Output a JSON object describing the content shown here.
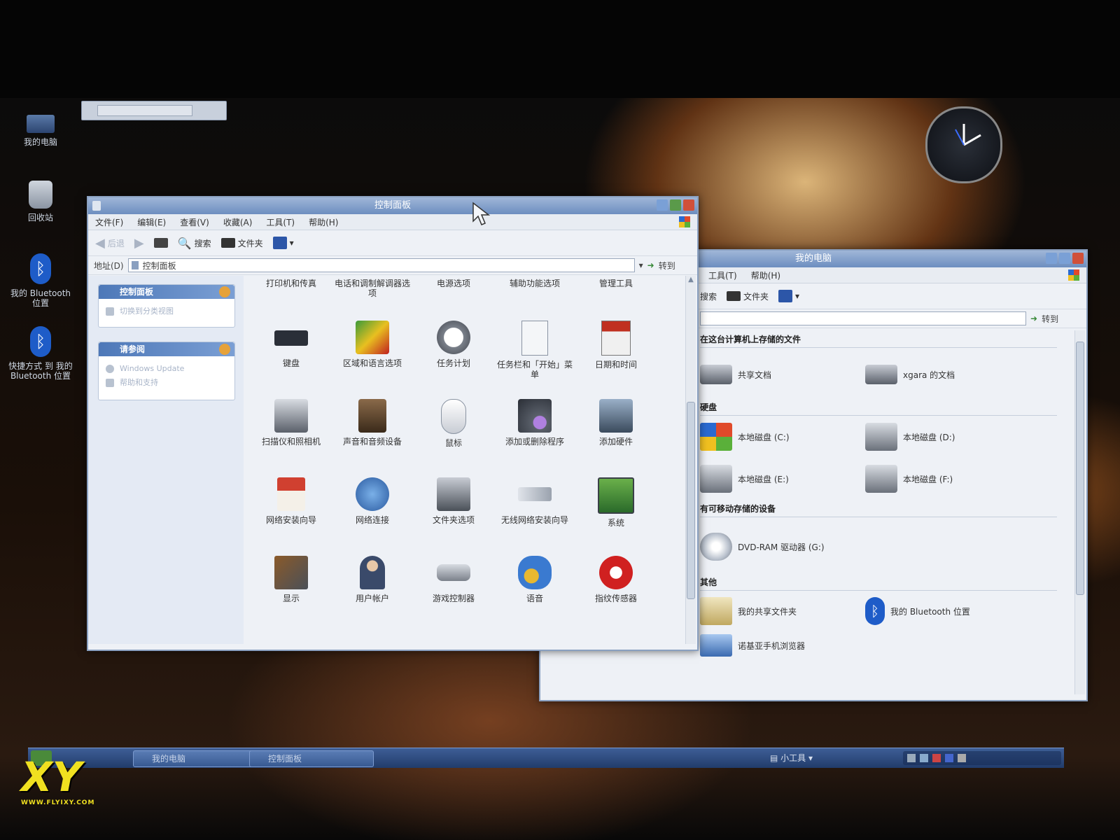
{
  "desktop": {
    "icons": [
      {
        "label": "我的电脑"
      },
      {
        "label": "回收站"
      },
      {
        "label": "我的 Bluetooth 位置"
      },
      {
        "label": "快捷方式 到 我的 Bluetooth 位置"
      }
    ]
  },
  "control_panel": {
    "title": "控制面板",
    "menu": [
      "文件(F)",
      "编辑(E)",
      "查看(V)",
      "收藏(A)",
      "工具(T)",
      "帮助(H)"
    ],
    "toolbar": {
      "back": "后退",
      "search": "搜索",
      "folders": "文件夹"
    },
    "address_label": "地址(D)",
    "address_value": "控制面板",
    "go_label": "转到",
    "side_panel": {
      "title": "控制面板",
      "switch_view": "切换到分类视图",
      "see_also_title": "请参阅",
      "see_also": [
        "Windows Update",
        "帮助和支持"
      ]
    },
    "top_row": [
      "打印机和传真",
      "电话和调制解调器选项",
      "电源选项",
      "辅助功能选项",
      "管理工具"
    ],
    "items": [
      "键盘",
      "区域和语言选项",
      "任务计划",
      "任务栏和「开始」菜单",
      "日期和时间",
      "扫描仪和照相机",
      "声音和音频设备",
      "鼠标",
      "添加或删除程序",
      "添加硬件",
      "网络安装向导",
      "网络连接",
      "文件夹选项",
      "无线网络安装向导",
      "系统",
      "显示",
      "用户帐户",
      "游戏控制器",
      "语音",
      "指纹传感器"
    ]
  },
  "my_computer": {
    "title": "我的电脑",
    "menu": [
      "工具(T)",
      "帮助(H)"
    ],
    "toolbar": {
      "search": "搜索",
      "folders": "文件夹"
    },
    "go_label": "转到",
    "groups": [
      {
        "title": "在这台计算机上存储的文件",
        "items": [
          "共享文档",
          "xgara 的文档"
        ]
      },
      {
        "title": "硬盘",
        "items": [
          "本地磁盘 (C:)",
          "本地磁盘 (D:)",
          "本地磁盘 (E:)",
          "本地磁盘 (F:)"
        ]
      },
      {
        "title": "有可移动存储的设备",
        "items": [
          "DVD-RAM 驱动器 (G:)"
        ]
      },
      {
        "title": "其他",
        "items": [
          "我的共享文件夹",
          "我的 Bluetooth 位置",
          "诺基亚手机浏览器"
        ]
      }
    ]
  },
  "taskbar": {
    "tasks": [
      "我的电脑",
      "控制面板"
    ],
    "gadgets": "小工具"
  },
  "watermark": {
    "brand": "XY",
    "url": "WWW.FLYIXY.COM"
  }
}
